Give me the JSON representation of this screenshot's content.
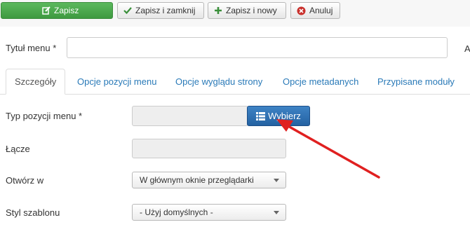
{
  "toolbar": {
    "save_label": "Zapisz",
    "save_close_label": "Zapisz i zamknij",
    "save_new_label": "Zapisz i nowy",
    "cancel_label": "Anuluj"
  },
  "form": {
    "title_label": "Tytuł menu *",
    "title_value": "",
    "cut_letter": "A"
  },
  "tabs": [
    {
      "label": "Szczegóły",
      "active": true
    },
    {
      "label": "Opcje pozycji menu"
    },
    {
      "label": "Opcje wyglądu strony"
    },
    {
      "label": "Opcje metadanych"
    },
    {
      "label": "Przypisane moduły"
    }
  ],
  "details": {
    "type_label": "Typ pozycji menu *",
    "choose_label": "Wybierz",
    "link_label": "Łącze",
    "open_label": "Otwórz w",
    "open_value": "W głównym oknie przeglądarki",
    "template_label": "Styl szablonu",
    "template_value": "- Użyj domyślnych -"
  },
  "colors": {
    "save": "#4cae4c",
    "primary": "#2f6fae",
    "link": "#2a7ab8",
    "arrow": "#e02020"
  }
}
